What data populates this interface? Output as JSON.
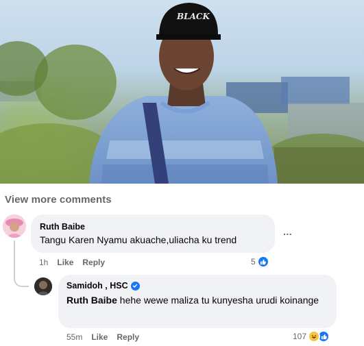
{
  "post": {
    "photo_alt": "photo",
    "cap_text": "BLACK"
  },
  "view_more_label": "View more comments",
  "comments": [
    {
      "author": "Ruth Baibe",
      "text": "Tangu Karen Nyamu akuache,uliacha ku trend",
      "time": "1h",
      "like_label": "Like",
      "reply_label": "Reply",
      "reaction_count": "5",
      "reactions": [
        "like-icon"
      ],
      "more_options": "..."
    },
    {
      "author": "Samidoh , HSC",
      "verified": true,
      "tag": "Ruth Baibe",
      "text": " hehe wewe maliza tu kunyesha urudi koinange",
      "time": "55m",
      "like_label": "Like",
      "reply_label": "Reply",
      "reaction_count": "107",
      "reactions": [
        "haha-icon",
        "like-icon"
      ]
    }
  ],
  "colors": {
    "bubble": "#f0f2f5",
    "meta_text": "#65676b",
    "facebook_blue": "#1877f2",
    "haha_yellow": "#f7c543"
  }
}
